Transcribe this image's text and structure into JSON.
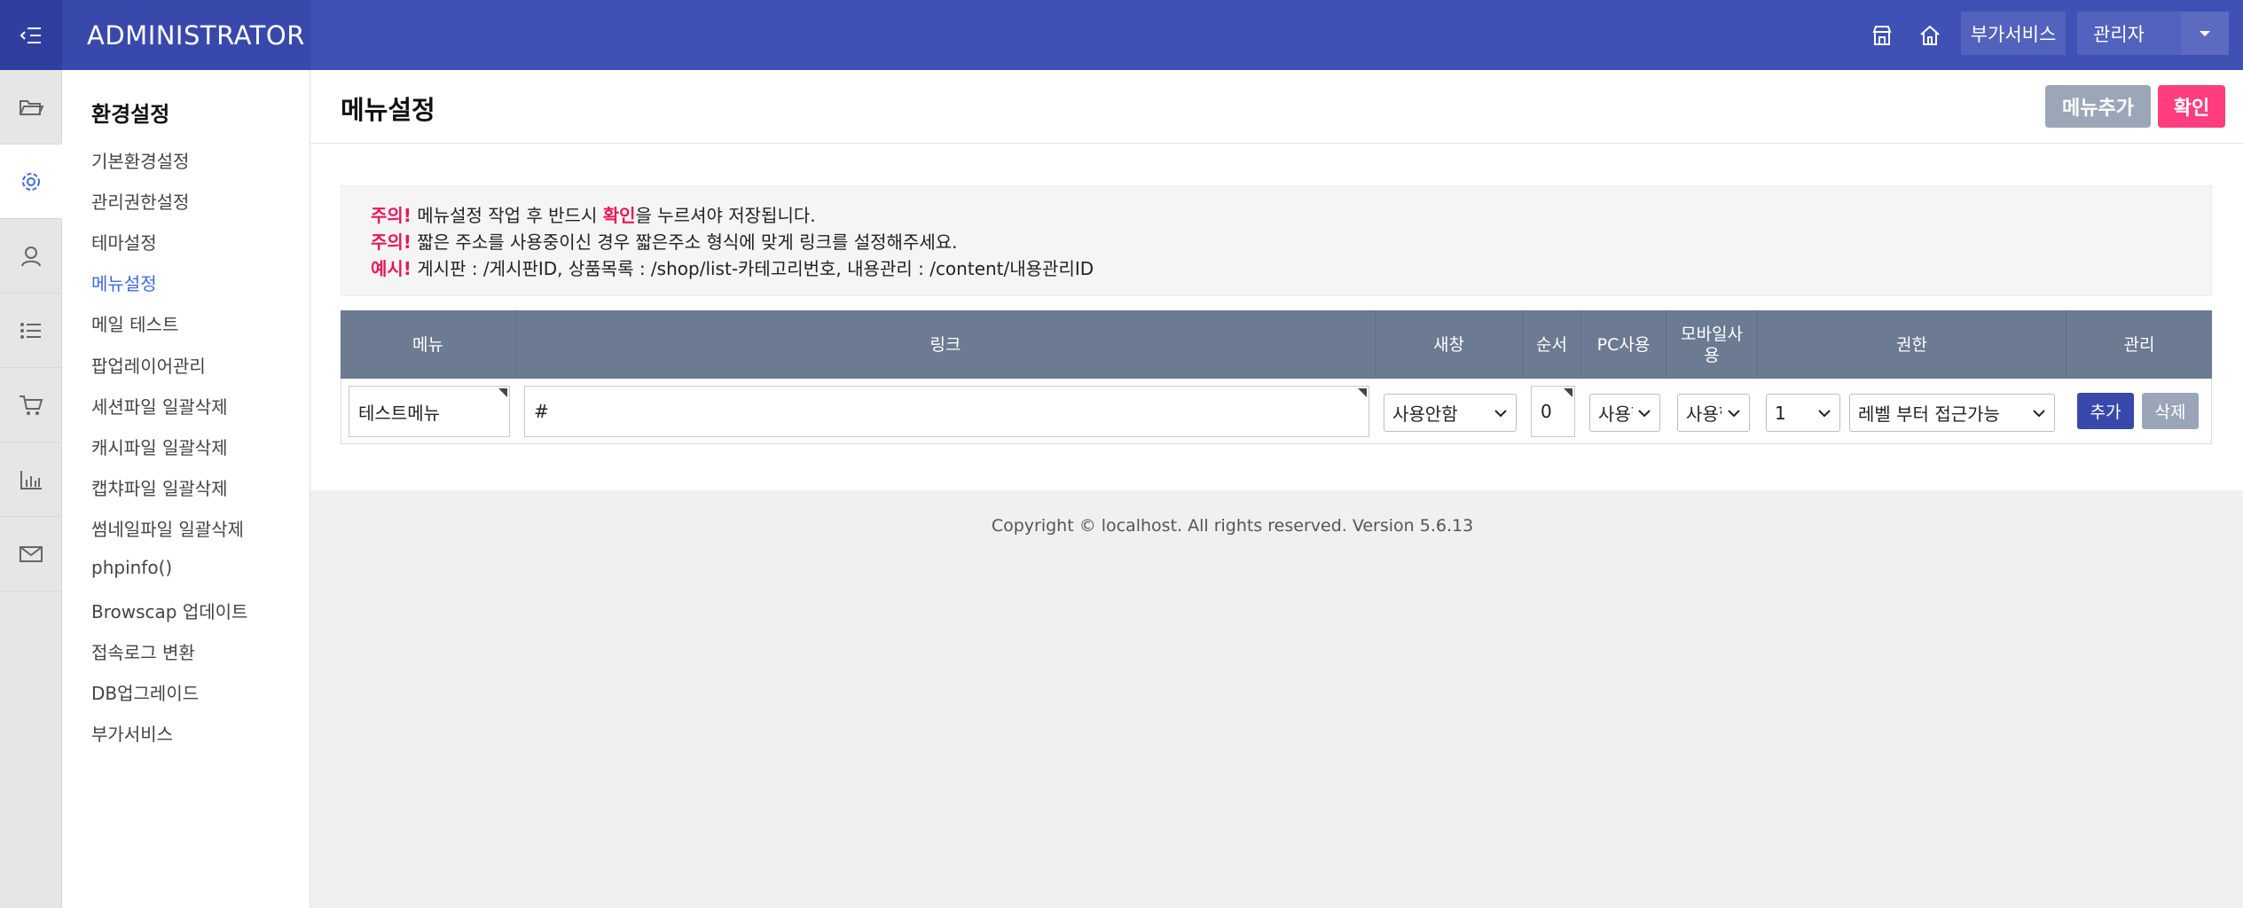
{
  "header": {
    "brand": "ADMINISTRATOR",
    "services_label": "부가서비스",
    "user_label": "관리자",
    "icons": [
      "menu-collapse-icon",
      "store-icon",
      "home-icon",
      "caret-down-icon"
    ],
    "colors": {
      "primary": "#3f51b5",
      "brand_bg": "#3949ab",
      "toggle_bg": "#303f9f"
    }
  },
  "rail": {
    "icons": [
      "folder-icon",
      "gear-icon",
      "user-icon",
      "list-icon",
      "cart-icon",
      "chart-icon",
      "mail-icon"
    ],
    "active": "gear-icon"
  },
  "submenu": {
    "title": "환경설정",
    "items": [
      {
        "label": "기본환경설정"
      },
      {
        "label": "관리권한설정"
      },
      {
        "label": "테마설정"
      },
      {
        "label": "메뉴설정",
        "active": true
      },
      {
        "label": "메일 테스트"
      },
      {
        "label": "팝업레이어관리"
      },
      {
        "label": "세션파일 일괄삭제"
      },
      {
        "label": "캐시파일 일괄삭제"
      },
      {
        "label": "캡챠파일 일괄삭제"
      },
      {
        "label": "썸네일파일 일괄삭제"
      },
      {
        "label": "phpinfo()"
      },
      {
        "label": "Browscap 업데이트"
      },
      {
        "label": "접속로그 변환"
      },
      {
        "label": "DB업그레이드"
      },
      {
        "label": "부가서비스"
      }
    ]
  },
  "page": {
    "title": "메뉴설정",
    "add_menu_label": "메뉴추가",
    "confirm_label": "확인"
  },
  "notice": {
    "line1": {
      "tag": "주의!",
      "pre": " 메뉴설정 작업 후 반드시 ",
      "hl": "확인",
      "post": "을 누르셔야 저장됩니다."
    },
    "line2": {
      "tag": "주의!",
      "text": " 짧은 주소를 사용중이신 경우 짧은주소 형식에 맞게 링크를 설정해주세요."
    },
    "line3": {
      "tag": "예시!",
      "text": " 게시판 : /게시판ID, 상품목록 : /shop/list-카테고리번호, 내용관리 : /content/내용관리ID"
    }
  },
  "table": {
    "headers": [
      "메뉴",
      "링크",
      "새창",
      "순서",
      "PC사용",
      "모바일사\n용",
      "권한",
      "관리"
    ],
    "row": {
      "menu": "테스트메뉴",
      "link": "#",
      "new_window": "사용안함",
      "order": "0",
      "pc_use": "사용함",
      "mobile_use": "사용함",
      "level": "1",
      "permission": "레벨 부터 접근가능",
      "add_label": "추가",
      "delete_label": "삭제"
    }
  },
  "footer": {
    "text": "Copyright © localhost. All rights reserved. Version 5.6.13"
  }
}
